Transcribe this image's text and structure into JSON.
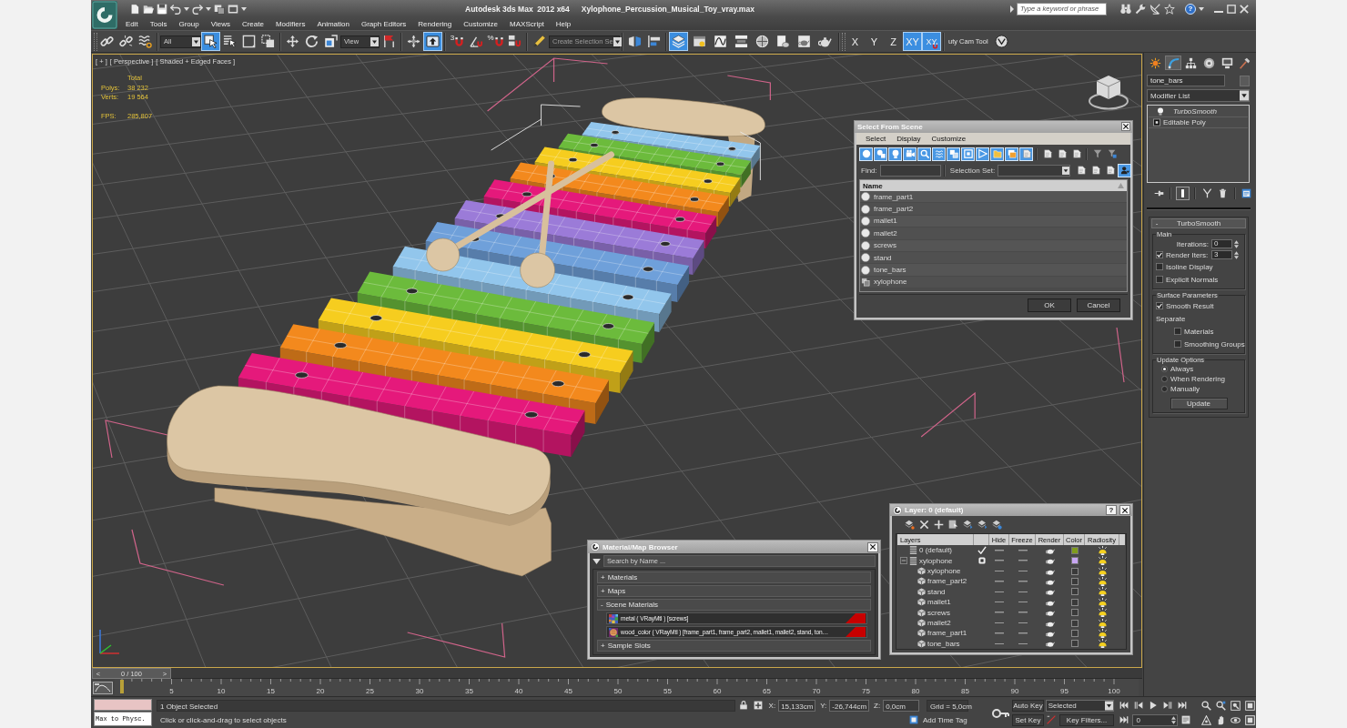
{
  "window": {
    "title": "Autodesk 3ds Max  2012 x64",
    "file": "Xylophone_Percussion_Musical_Toy_vray.max",
    "search": {
      "placeholder": "Type a keyword or phrase"
    },
    "help": "?"
  },
  "menu": [
    "Edit",
    "Tools",
    "Group",
    "Views",
    "Create",
    "Modifiers",
    "Animation",
    "Graph Editors",
    "Rendering",
    "Customize",
    "MAXScript",
    "Help"
  ],
  "toolbar": {
    "groups": [
      [
        {
          "kind": "button",
          "selected": false
        },
        {
          "kind": "button",
          "selected": false
        },
        {
          "kind": "button",
          "selected": false
        }
      ],
      [
        {
          "kind": "dropdown",
          "value": "All"
        },
        {
          "kind": "button",
          "selected": true
        },
        {
          "kind": "button",
          "selected": false
        },
        {
          "kind": "button",
          "selected": false
        },
        {
          "kind": "button",
          "selected": false
        }
      ],
      [
        {
          "kind": "button",
          "selected": false
        },
        {
          "kind": "button",
          "selected": false
        },
        {
          "kind": "button",
          "selected": false
        },
        {
          "kind": "dropdown",
          "value": "View"
        },
        {
          "kind": "button",
          "selected": false
        }
      ],
      [
        {
          "kind": "button",
          "selected": false
        },
        {
          "kind": "button",
          "selected": true
        }
      ],
      [
        {
          "kind": "button",
          "label": "3",
          "selected": false
        },
        {
          "kind": "button",
          "selected": false
        },
        {
          "kind": "button",
          "label": "%",
          "selected": false
        },
        {
          "kind": "button",
          "selected": false
        }
      ],
      [
        {
          "kind": "button",
          "selected": false
        },
        {
          "kind": "dropdown",
          "placeholder": "Create Selection Se"
        }
      ],
      [
        {
          "kind": "button",
          "selected": false
        },
        {
          "kind": "button",
          "selected": false
        }
      ],
      [
        {
          "kind": "button",
          "selected": true
        },
        {
          "kind": "button",
          "selected": false
        },
        {
          "kind": "button",
          "selected": false
        },
        {
          "kind": "button",
          "selected": false
        },
        {
          "kind": "button",
          "selected": false
        },
        {
          "kind": "button",
          "selected": false
        },
        {
          "kind": "button",
          "selected": false
        },
        {
          "kind": "button",
          "selected": false
        }
      ]
    ],
    "axes": [
      {
        "kind": "axis",
        "label": "X",
        "selected": false
      },
      {
        "kind": "axis",
        "label": "Y",
        "selected": false
      },
      {
        "kind": "axis",
        "label": "Z",
        "selected": false
      },
      {
        "kind": "axis",
        "label": "XY",
        "selected": true
      },
      {
        "kind": "snap",
        "label": "XY",
        "selected": true
      }
    ],
    "cam_tool": {
      "label": "uty Cam Tool"
    }
  },
  "viewport": {
    "active": true,
    "labels": [
      "[ + ]",
      "[ Perspective ]",
      "[ Shaded + Edged Faces ]"
    ],
    "stats": {
      "header": "Total",
      "rows": [
        {
          "kind": "count",
          "label": "Polys:",
          "value": "38 232"
        },
        {
          "kind": "count",
          "label": "Verts:",
          "value": "19 564"
        },
        {
          "kind": "rate",
          "label": "FPS:",
          "value": "285,807"
        }
      ]
    }
  },
  "select_dialog": {
    "title": "Select From Scene",
    "menu": [
      "Select",
      "Display",
      "Customize"
    ],
    "filters": [
      {
        "selected": true
      },
      {
        "selected": true
      },
      {
        "selected": true
      },
      {
        "selected": true
      },
      {
        "selected": true
      },
      {
        "selected": true
      },
      {
        "selected": true
      },
      {
        "selected": true
      },
      {
        "selected": true
      },
      {
        "selected": true
      },
      {
        "selected": true
      },
      {
        "selected": true
      }
    ],
    "find": {
      "label": "Find:"
    },
    "selection_set": {
      "label": "Selection Set:"
    },
    "sync": {
      "selected": true
    },
    "columns": [
      "Name"
    ],
    "rows": [
      {
        "kind": "object",
        "name": "frame_part1",
        "selected": false
      },
      {
        "kind": "object",
        "name": "frame_part2",
        "selected": false
      },
      {
        "kind": "object",
        "name": "mallet1",
        "selected": false
      },
      {
        "kind": "object",
        "name": "mallet2",
        "selected": false
      },
      {
        "kind": "object",
        "name": "screws",
        "selected": false
      },
      {
        "kind": "object",
        "name": "stand",
        "selected": false
      },
      {
        "kind": "object",
        "name": "tone_bars",
        "selected": false
      },
      {
        "kind": "group",
        "name": "xylophone",
        "selected": false
      }
    ],
    "buttons": [
      "OK",
      "Cancel"
    ]
  },
  "material_browser": {
    "title": "Material/Map Browser",
    "search": {
      "placeholder": "Search by Name ..."
    },
    "sections": [
      {
        "toggle": "+",
        "title": "Materials"
      },
      {
        "toggle": "+",
        "title": "Maps"
      },
      {
        "toggle": "-",
        "title": "Scene Materials",
        "items": [
          {
            "label": "metal ( VRayMtl ) [screws]"
          },
          {
            "label": "wood_color ( VRayMtl ) [frame_part1, frame_part2, mallet1, mallet2, stand, ton…"
          }
        ]
      },
      {
        "toggle": "+",
        "title": "Sample Slots"
      }
    ]
  },
  "layer_dialog": {
    "title": "Layer: 0 (default)",
    "help": "?",
    "columns": [
      "Layers",
      "Hide",
      "Freeze",
      "Render",
      "Color",
      "Radiosity"
    ],
    "layers": [
      {
        "kind": "layer",
        "name": "0 (default)",
        "current": true,
        "hidden": false,
        "frozen": false,
        "renderable": true,
        "color": "#7f9b1c",
        "radiosity": true
      },
      {
        "kind": "layer",
        "name": "xylophone",
        "current": false,
        "expanded": true,
        "hidden": false,
        "frozen": false,
        "renderable": true,
        "color": "#c7a6f2",
        "radiosity": true,
        "children": [
          {
            "kind": "object",
            "name": "xylophone",
            "hidden": false,
            "frozen": false,
            "renderable": true,
            "radiosity": true
          },
          {
            "kind": "object",
            "name": "frame_part2",
            "hidden": false,
            "frozen": false,
            "renderable": true,
            "radiosity": true
          },
          {
            "kind": "object",
            "name": "stand",
            "hidden": false,
            "frozen": false,
            "renderable": true,
            "radiosity": true
          },
          {
            "kind": "object",
            "name": "mallet1",
            "hidden": false,
            "frozen": false,
            "renderable": true,
            "radiosity": true
          },
          {
            "kind": "object",
            "name": "screws",
            "hidden": false,
            "frozen": false,
            "renderable": true,
            "radiosity": true
          },
          {
            "kind": "object",
            "name": "mallet2",
            "hidden": false,
            "frozen": false,
            "renderable": true,
            "radiosity": true
          },
          {
            "kind": "object",
            "name": "frame_part1",
            "hidden": false,
            "frozen": false,
            "renderable": true,
            "radiosity": true
          },
          {
            "kind": "object",
            "name": "tone_bars",
            "hidden": false,
            "frozen": false,
            "renderable": true,
            "radiosity": true
          }
        ]
      }
    ]
  },
  "command_panel": {
    "tabs": [
      {
        "selected": false
      },
      {
        "selected": true
      },
      {
        "selected": false
      },
      {
        "selected": false
      },
      {
        "selected": false
      },
      {
        "selected": false
      }
    ],
    "object_name": "tone_bars",
    "modifier_list": "Modifier List",
    "stack": [
      {
        "kind": "modifier",
        "name": "TurboSmooth",
        "instanced": true,
        "selected": false
      },
      {
        "kind": "base",
        "name": "Editable Poly",
        "instanced": false,
        "selected": false
      }
    ],
    "stack_tools": [
      {
        "selected": false
      },
      {
        "selected": true
      },
      {
        "selected": false
      },
      {
        "selected": false
      },
      {
        "selected": false
      }
    ],
    "rollout": {
      "toggle": "-",
      "title": "TurboSmooth",
      "groups": [
        {
          "title": "Main",
          "controls": [
            {
              "kind": "spinner",
              "label": "Iterations:",
              "value": "0"
            },
            {
              "kind": "checkspinner",
              "label": "Render Iters:",
              "value": "3",
              "checked": true
            },
            {
              "kind": "checkbox",
              "label": "Isoline Display",
              "checked": false
            },
            {
              "kind": "checkbox",
              "label": "Explicit Normals",
              "checked": false
            }
          ]
        },
        {
          "title": "Surface Parameters",
          "controls": [
            {
              "kind": "checkbox",
              "label": "Smooth Result",
              "checked": true
            },
            {
              "kind": "label",
              "label": "Separate",
              "children": [
                {
                  "kind": "checkbox",
                  "label": "Materials",
                  "checked": false
                },
                {
                  "kind": "checkbox",
                  "label": "Smoothing Groups",
                  "checked": false
                }
              ]
            }
          ]
        },
        {
          "title": "Update Options",
          "controls": [
            {
              "kind": "radio",
              "label": "Always",
              "selected": true
            },
            {
              "kind": "radio",
              "label": "When Rendering",
              "selected": false
            },
            {
              "kind": "radio",
              "label": "Manually",
              "selected": false
            },
            {
              "kind": "button",
              "label": "Update"
            }
          ]
        }
      ]
    }
  },
  "timeline": {
    "prev": "<",
    "frame": "0 / 100",
    "next": ">",
    "level": 0,
    "ticks": [
      "5",
      "10",
      "15",
      "20",
      "25",
      "30",
      "35",
      "40",
      "45",
      "50",
      "55",
      "60",
      "65",
      "70",
      "75",
      "80",
      "85",
      "90",
      "95",
      "100"
    ]
  },
  "status": {
    "listener": {
      "value": "Max to Physc."
    },
    "prompt": "1 Object Selected",
    "hint": "Click or click-and-drag to select objects",
    "coords": [
      {
        "label": "X:",
        "value": "15,133cm"
      },
      {
        "label": "Y:",
        "value": "-26,744cm"
      },
      {
        "label": "Z:",
        "value": "0,0cm"
      }
    ],
    "grid": "Grid = 5,0cm",
    "time_tag": "Add Time Tag",
    "auto_key": {
      "label": "Auto Key",
      "on": false
    },
    "set_key": {
      "label": "Set Key"
    },
    "key_mode": {
      "value": "Selected"
    },
    "key_filters": {
      "label": "Key Filters..."
    },
    "frame": {
      "value": "0"
    }
  }
}
